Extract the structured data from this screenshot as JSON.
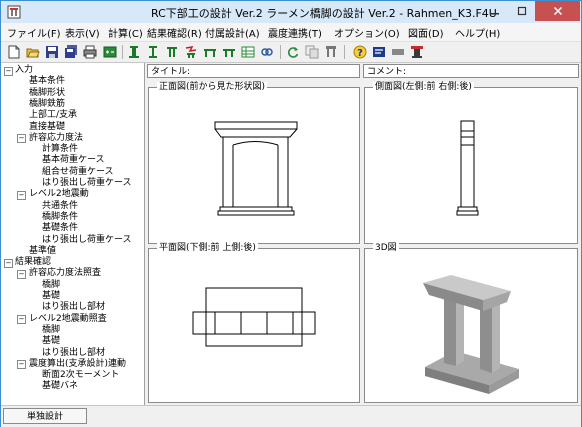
{
  "window": {
    "title": "RC下部工の設計 Ver.2 ラーメン橋脚の設計 Ver.2 - Rahmen_K3.F4U"
  },
  "menu": {
    "items": [
      "ファイル(F)",
      "表示(V)",
      "計算(C)",
      "結果確認(R)",
      "付属設計(A)",
      "震度連携(T)",
      "オプション(O)",
      "図面(D)",
      "ヘルプ(H)"
    ]
  },
  "toolbar": {
    "icons": [
      "new-icon",
      "open-icon",
      "save-icon",
      "save-all-icon",
      "print-icon",
      "calc-icon",
      "structure-icon",
      "pile-icon",
      "beam-icon",
      "frame-icon",
      "table-icon",
      "link-icon",
      "refresh-icon",
      "copy-icon",
      "drawing-icon",
      "help-icon",
      "manual-icon",
      "status-icon",
      "pier-icon"
    ]
  },
  "tree": {
    "items": [
      {
        "label": "入力",
        "toggle": "−"
      },
      {
        "label": "基本条件"
      },
      {
        "label": "橋脚形状"
      },
      {
        "label": "橋脚鉄筋"
      },
      {
        "label": "上部工/支承"
      },
      {
        "label": "直接基礎"
      },
      {
        "label": "許容応力度法",
        "toggle": "−"
      },
      {
        "label": "計算条件"
      },
      {
        "label": "基本荷重ケース"
      },
      {
        "label": "組合せ荷重ケース"
      },
      {
        "label": "はり張出し荷重ケース"
      },
      {
        "label": "レベル2地震動",
        "toggle": "−"
      },
      {
        "label": "共通条件"
      },
      {
        "label": "橋脚条件"
      },
      {
        "label": "基礎条件"
      },
      {
        "label": "はり張出し荷重ケース"
      },
      {
        "label": "基準値"
      },
      {
        "label": "結果確認",
        "toggle": "−"
      },
      {
        "label": "許容応力度法照査",
        "toggle": "−"
      },
      {
        "label": "橋脚"
      },
      {
        "label": "基礎"
      },
      {
        "label": "はり張出し部材"
      },
      {
        "label": "レベル2地震動照査",
        "toggle": "−"
      },
      {
        "label": "橋脚"
      },
      {
        "label": "基礎"
      },
      {
        "label": "はり張出し部材"
      },
      {
        "label": "震度算出(支承設計)連動",
        "toggle": "−"
      },
      {
        "label": "断面2次モーメント"
      },
      {
        "label": "基礎バネ"
      }
    ]
  },
  "fields": {
    "title_label": "タイトル:",
    "comment_label": "コメント:"
  },
  "views": {
    "front": "正面図(前から見た形状図)",
    "side": "側面図(左側:前 右側:後)",
    "plan": "平面図(下側:前 上側:後)",
    "threed": "3D図"
  },
  "status": {
    "tab": "単独設計"
  }
}
